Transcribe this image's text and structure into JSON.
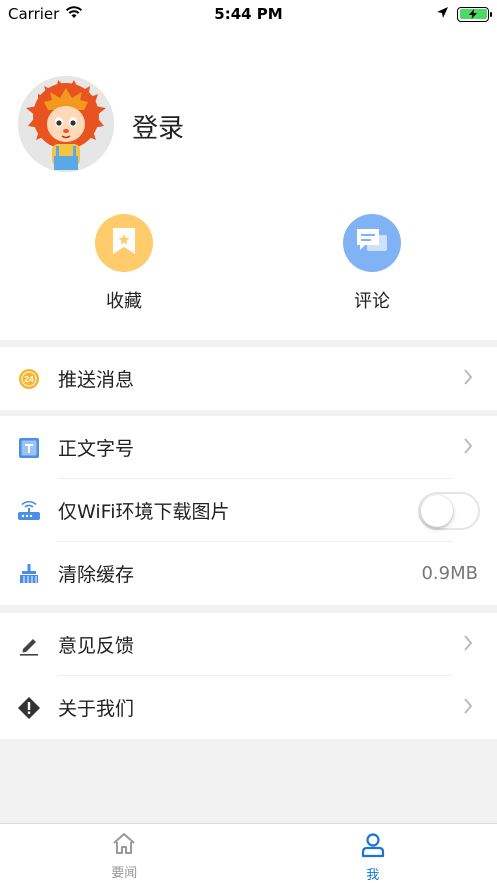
{
  "status_bar": {
    "carrier": "Carrier",
    "time": "5:44 PM"
  },
  "profile": {
    "login_label": "登录",
    "quick_actions": [
      {
        "label": "收藏",
        "icon": "bookmark-star-icon",
        "color": "#ffcb6b"
      },
      {
        "label": "评论",
        "icon": "comment-icon",
        "color": "#7fb3f5"
      }
    ]
  },
  "settings": {
    "push": {
      "label": "推送消息",
      "icon": "push-24-icon"
    },
    "font_size": {
      "label": "正文字号",
      "icon": "text-size-icon"
    },
    "wifi_images": {
      "label": "仅WiFi环境下载图片",
      "icon": "router-icon",
      "enabled": false
    },
    "clear_cache": {
      "label": "清除缓存",
      "value": "0.9MB",
      "icon": "broom-icon"
    },
    "feedback": {
      "label": "意见反馈",
      "icon": "pencil-icon"
    },
    "about": {
      "label": "关于我们",
      "icon": "info-diamond-icon"
    }
  },
  "tab_bar": {
    "tabs": [
      {
        "label": "要闻",
        "icon": "home-icon",
        "active": false
      },
      {
        "label": "我",
        "icon": "person-icon",
        "active": true
      }
    ],
    "active_color": "#1a73d9"
  }
}
